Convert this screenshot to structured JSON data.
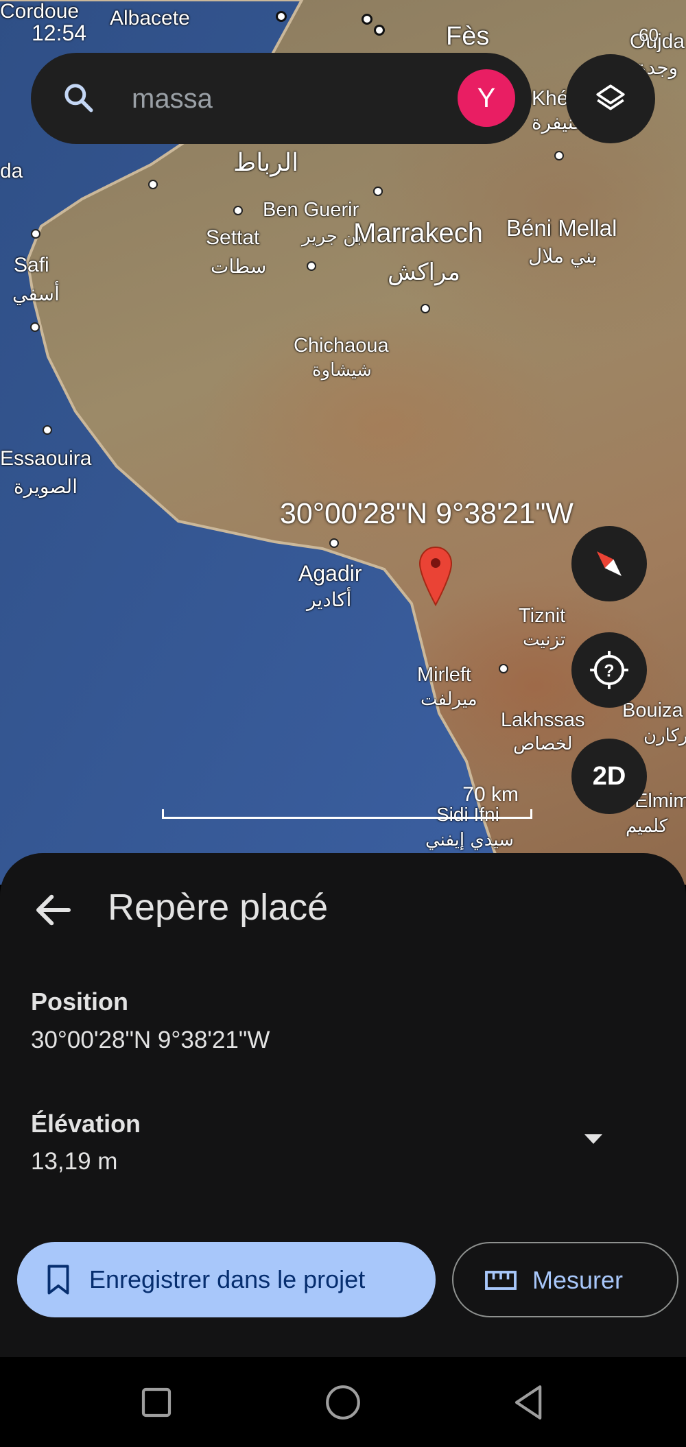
{
  "status_bar": {
    "time": "12:54",
    "right": "60"
  },
  "search": {
    "placeholder": "massa",
    "avatar_letter": "Y"
  },
  "map": {
    "coordinate_label": "30°00'28\"N 9°38'21\"W",
    "scale_text": "70 km",
    "places": [
      {
        "name": "Cordoue"
      },
      {
        "name": "Albacete"
      },
      {
        "name": "Fès"
      },
      {
        "name": "Oujda"
      },
      {
        "name": "وجدة"
      },
      {
        "name": "Khén"
      },
      {
        "name": "خنيفرة"
      },
      {
        "name": "الرباط"
      },
      {
        "name": "da"
      },
      {
        "name": "Ben Guerir"
      },
      {
        "name": "بن جرير"
      },
      {
        "name": "Settat"
      },
      {
        "name": "سطات"
      },
      {
        "name": "Marrakech"
      },
      {
        "name": "مراكش"
      },
      {
        "name": "Béni Mellal"
      },
      {
        "name": "بني ملال"
      },
      {
        "name": "Safi"
      },
      {
        "name": "أسفي"
      },
      {
        "name": "Chichaoua"
      },
      {
        "name": "شيشاوة"
      },
      {
        "name": "Essaouira"
      },
      {
        "name": "الصويرة"
      },
      {
        "name": "Agadir"
      },
      {
        "name": "أكادير"
      },
      {
        "name": "Tiznit"
      },
      {
        "name": "تزنيت"
      },
      {
        "name": "Mirleft"
      },
      {
        "name": "ميرلفت"
      },
      {
        "name": "Lakhssas"
      },
      {
        "name": "لخصاص"
      },
      {
        "name": "Bouiza"
      },
      {
        "name": "ركارن"
      },
      {
        "name": "Sidi Ifni"
      },
      {
        "name": "سيدي إيفني"
      },
      {
        "name": "Elmim"
      },
      {
        "name": "كلميم"
      }
    ],
    "twod_label": "2D"
  },
  "sheet": {
    "title": "Repère placé",
    "position_label": "Position",
    "position_value": "30°00'28\"N 9°38'21\"W",
    "elevation_label": "Élévation",
    "elevation_value": "13,19 m",
    "save_button": "Enregistrer dans le projet",
    "measure_button": "Mesurer"
  },
  "colors": {
    "accent": "#a8c7fa",
    "avatar": "#e91e63",
    "pin": "#ea4335",
    "sheet": "#131314"
  },
  "icons": [
    "search-icon",
    "layers-icon",
    "compass-icon",
    "help-icon",
    "back-arrow-icon",
    "dropdown-icon",
    "bookmark-icon",
    "ruler-icon",
    "recents-icon",
    "home-icon",
    "back-nav-icon"
  ]
}
